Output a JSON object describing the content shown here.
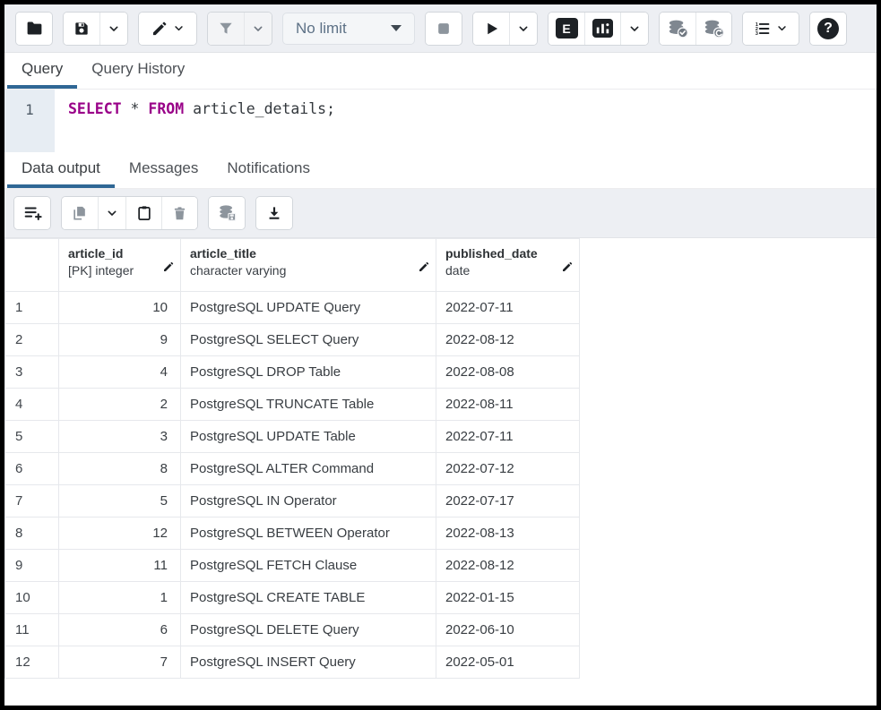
{
  "colors": {
    "accent_underline": "#2f6795",
    "sql_keyword": "#990088",
    "toolbar_bg": "#edeff3",
    "dark_icon": "#1d2125",
    "disabled_icon": "#8d959d",
    "frame_border": "#000000"
  },
  "toolbar": {
    "limit_select": {
      "value": "No limit"
    },
    "explain_label": "E",
    "help_label": "?",
    "icons": [
      "folder-icon",
      "save-icon",
      "chevron-down-icon",
      "edit-pencil-icon",
      "filter-icon",
      "stop-icon",
      "play-icon",
      "explain-icon",
      "explain-analyze-icon",
      "commit-icon",
      "rollback-icon",
      "macros-icon",
      "help-icon"
    ]
  },
  "query_tabs": {
    "tabs": [
      {
        "label": "Query",
        "active": true
      },
      {
        "label": "Query History",
        "active": false
      }
    ]
  },
  "editor": {
    "line_number": "1",
    "sql": {
      "kw1": "SELECT",
      "star": " * ",
      "kw2": "FROM",
      "rest": " article_details;"
    }
  },
  "output_tabs": {
    "tabs": [
      {
        "label": "Data output",
        "active": true
      },
      {
        "label": "Messages",
        "active": false
      },
      {
        "label": "Notifications",
        "active": false
      }
    ]
  },
  "results_toolbar": {
    "icons": [
      "add-row-icon",
      "copy-icon",
      "chevron-down-icon",
      "paste-icon",
      "delete-row-icon",
      "save-data-changes-icon",
      "download-csv-icon"
    ]
  },
  "table": {
    "columns": [
      {
        "name": "article_id",
        "type": "[PK] integer"
      },
      {
        "name": "article_title",
        "type": "character varying"
      },
      {
        "name": "published_date",
        "type": "date"
      }
    ],
    "rows": [
      {
        "num": "1",
        "article_id": "10",
        "article_title": "PostgreSQL UPDATE Query",
        "published_date": "2022-07-11"
      },
      {
        "num": "2",
        "article_id": "9",
        "article_title": "PostgreSQL SELECT Query",
        "published_date": "2022-08-12"
      },
      {
        "num": "3",
        "article_id": "4",
        "article_title": "PostgreSQL DROP Table",
        "published_date": "2022-08-08"
      },
      {
        "num": "4",
        "article_id": "2",
        "article_title": "PostgreSQL TRUNCATE Table",
        "published_date": "2022-08-11"
      },
      {
        "num": "5",
        "article_id": "3",
        "article_title": "PostgreSQL UPDATE Table",
        "published_date": "2022-07-11"
      },
      {
        "num": "6",
        "article_id": "8",
        "article_title": "PostgreSQL ALTER Command",
        "published_date": "2022-07-12"
      },
      {
        "num": "7",
        "article_id": "5",
        "article_title": "PostgreSQL IN Operator",
        "published_date": "2022-07-17"
      },
      {
        "num": "8",
        "article_id": "12",
        "article_title": "PostgreSQL BETWEEN Operator",
        "published_date": "2022-08-13"
      },
      {
        "num": "9",
        "article_id": "11",
        "article_title": "PostgreSQL FETCH Clause",
        "published_date": "2022-08-12"
      },
      {
        "num": "10",
        "article_id": "1",
        "article_title": "PostgreSQL CREATE TABLE",
        "published_date": "2022-01-15"
      },
      {
        "num": "11",
        "article_id": "6",
        "article_title": "PostgreSQL DELETE Query",
        "published_date": "2022-06-10"
      },
      {
        "num": "12",
        "article_id": "7",
        "article_title": "PostgreSQL INSERT Query",
        "published_date": "2022-05-01"
      }
    ]
  }
}
